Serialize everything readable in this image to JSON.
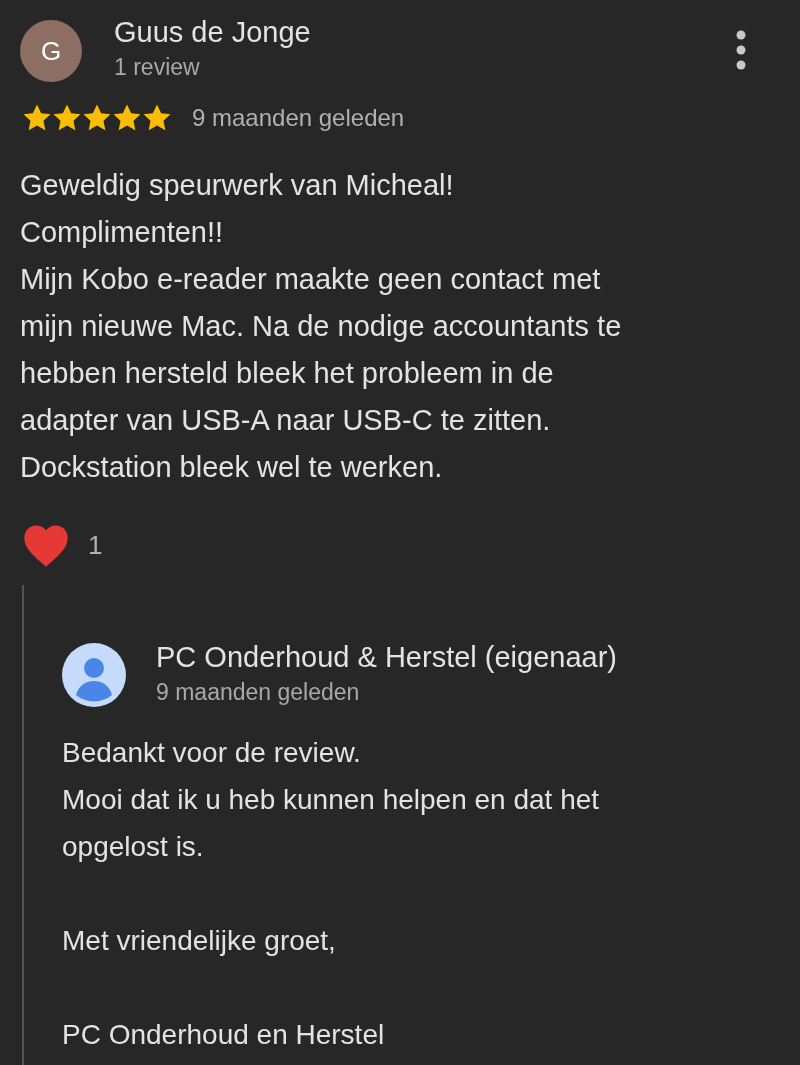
{
  "review": {
    "avatar_letter": "G",
    "author": "Guus de Jonge",
    "author_meta": "1 review",
    "stars": 5,
    "time": "9 maanden geleden",
    "lines": [
      "Geweldig speurwerk van Micheal!",
      "Complimenten!!",
      "Mijn Kobo e-reader maakte geen contact met",
      "mijn nieuwe Mac. Na de nodige accountants te",
      "hebben hersteld bleek het probleem in de",
      "adapter van USB-A naar USB-C te zitten.",
      "Dockstation bleek wel te werken."
    ],
    "reactions": {
      "liked": true,
      "count": "1"
    }
  },
  "reply": {
    "author": "PC Onderhoud & Herstel (eigenaar)",
    "time": "9 maanden geleden",
    "paragraphs": [
      [
        "Bedankt voor de review.",
        "Mooi dat ik u heb kunnen helpen en dat het",
        "opgelost is."
      ],
      [
        "Met vriendelijke groet,"
      ],
      [
        "PC Onderhoud en Herstel"
      ]
    ]
  }
}
